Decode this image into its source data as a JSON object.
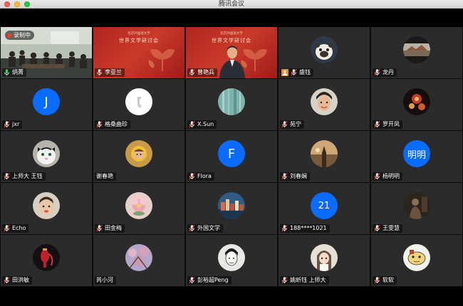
{
  "window": {
    "title": "腾讯会议"
  },
  "colors": {
    "tile_bg": "#2b2b2b",
    "active_speaker": "#2bd45a",
    "avatar_blue": "#0a6cff",
    "record": "#ff3b30"
  },
  "meeting": {
    "recording_label": "录制中",
    "slide": {
      "org": "北京外国语大学",
      "title": "世界文学研讨会"
    }
  },
  "participants": [
    {
      "name": "炳菁",
      "kind": "video-room",
      "mic": "green"
    },
    {
      "name": "李亚兰",
      "kind": "slide",
      "mic": "muted"
    },
    {
      "name": "曾艳兵",
      "kind": "slide-person",
      "mic": "muted"
    },
    {
      "name": "盛钰",
      "kind": "photo",
      "avatar": "pug",
      "mic": "muted",
      "icon": "user-icon"
    },
    {
      "name": "龙丹",
      "kind": "photo",
      "avatar": "landscape",
      "mic": "muted"
    },
    {
      "name": "jxr",
      "kind": "letter",
      "letter": "J",
      "mic": "muted"
    },
    {
      "name": "格桑曲珍",
      "kind": "photo",
      "avatar": "white-logo",
      "mic": "muted"
    },
    {
      "name": "X.Sun",
      "kind": "photo",
      "avatar": "teal",
      "mic": "muted"
    },
    {
      "name": "苑宁",
      "kind": "photo",
      "avatar": "face",
      "mic": "muted"
    },
    {
      "name": "罗开凤",
      "kind": "photo",
      "avatar": "dark-floral",
      "mic": "muted"
    },
    {
      "name": "上师大 王钰",
      "kind": "photo",
      "avatar": "cat",
      "mic": "muted"
    },
    {
      "name": "谢春艳",
      "kind": "photo",
      "avatar": "sunflower",
      "mic": "none"
    },
    {
      "name": "Flora",
      "kind": "letter",
      "letter": "F",
      "mic": "muted"
    },
    {
      "name": "刘春娴",
      "kind": "photo",
      "avatar": "sunset",
      "mic": "muted"
    },
    {
      "name": "杨明明",
      "kind": "letter",
      "letter": "明明",
      "mic": "muted"
    },
    {
      "name": "Echo",
      "kind": "photo",
      "avatar": "child",
      "mic": "muted"
    },
    {
      "name": "田金梅",
      "kind": "photo",
      "avatar": "pink-flower",
      "mic": "muted"
    },
    {
      "name": "外国文学",
      "kind": "photo",
      "avatar": "city",
      "mic": "muted"
    },
    {
      "name": "188****1021",
      "kind": "letter",
      "letter": "21",
      "mic": "muted"
    },
    {
      "name": "王雯慧",
      "kind": "photo",
      "avatar": "dark-figure",
      "mic": "muted"
    },
    {
      "name": "田洪敏",
      "kind": "photo",
      "avatar": "red-lantern",
      "mic": "muted"
    },
    {
      "name": "芮小河",
      "kind": "photo",
      "avatar": "blossom",
      "mic": "none"
    },
    {
      "name": "彭裕超Peng",
      "kind": "photo",
      "avatar": "sketch",
      "mic": "muted"
    },
    {
      "name": "姚昕钰 上师大",
      "kind": "photo",
      "avatar": "anime",
      "mic": "muted"
    },
    {
      "name": "软软",
      "kind": "photo",
      "avatar": "cartoon",
      "mic": "muted"
    }
  ]
}
